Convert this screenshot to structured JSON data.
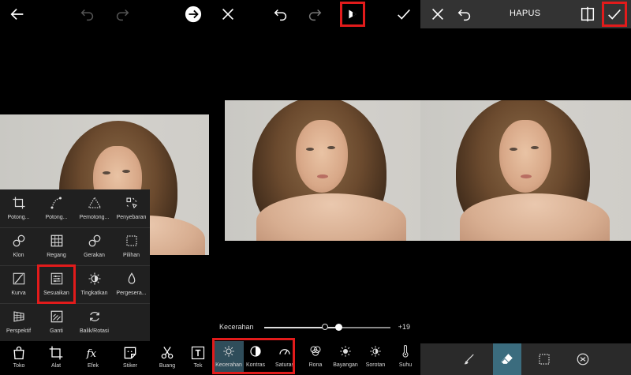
{
  "panel1": {
    "tools": [
      {
        "label": "Potong...",
        "icon": "crop-icon"
      },
      {
        "label": "Potong...",
        "icon": "freecrop-icon"
      },
      {
        "label": "Pemotong...",
        "icon": "shape-crop-icon"
      },
      {
        "label": "Penyebaran",
        "icon": "dispersion-icon"
      },
      {
        "label": "Klon",
        "icon": "clone-icon"
      },
      {
        "label": "Regang",
        "icon": "stretch-icon"
      },
      {
        "label": "Gerakan",
        "icon": "motion-icon"
      },
      {
        "label": "Pilihan",
        "icon": "selection-icon"
      },
      {
        "label": "Kurva",
        "icon": "curves-icon"
      },
      {
        "label": "Sesuaikan",
        "icon": "adjust-icon"
      },
      {
        "label": "Tingkatkan",
        "icon": "enhance-icon"
      },
      {
        "label": "Pergesera...",
        "icon": "tilt-shift-icon"
      },
      {
        "label": "Perspektif",
        "icon": "perspective-icon"
      },
      {
        "label": "Ganti",
        "icon": "replace-icon"
      },
      {
        "label": "Balik/Rotasi",
        "icon": "flip-rotate-icon"
      }
    ],
    "nav": [
      {
        "label": "Toko",
        "icon": "shop-bag-icon"
      },
      {
        "label": "Alat",
        "icon": "crop-tool-icon"
      },
      {
        "label": "Efek",
        "icon": "fx-icon"
      },
      {
        "label": "Stiker",
        "icon": "sticker-icon"
      },
      {
        "label": "Buang",
        "icon": "cutout-icon"
      },
      {
        "label": "Tek",
        "icon": "text-icon"
      }
    ]
  },
  "panel2": {
    "slider": {
      "label": "Kecerahan",
      "value": "+19",
      "level": 0.59
    },
    "tools": [
      {
        "label": "Kecerahan",
        "icon": "brightness-icon"
      },
      {
        "label": "Kontras",
        "icon": "contrast-icon"
      },
      {
        "label": "Saturas",
        "icon": "saturation-icon"
      },
      {
        "label": "Rona",
        "icon": "hue-icon"
      },
      {
        "label": "Bayangan",
        "icon": "shadows-icon"
      },
      {
        "label": "Sorotan",
        "icon": "highlights-icon"
      },
      {
        "label": "Suhu",
        "icon": "temperature-icon"
      }
    ]
  },
  "panel3": {
    "title": "HAPUS",
    "tools": [
      {
        "icon": "brush-icon"
      },
      {
        "icon": "eraser-icon"
      },
      {
        "icon": "selection-icon"
      },
      {
        "icon": "person-select-icon"
      }
    ]
  },
  "colors": {
    "highlight": "#e21b1b",
    "active_tool": "#3b6c7e",
    "menu_bg": "#202020"
  }
}
